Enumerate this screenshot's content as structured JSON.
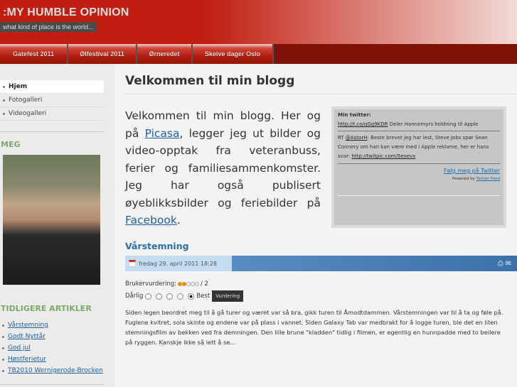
{
  "header": {
    "title": ":MY HUMBLE OPINION",
    "tagline": "what kind of place is the world..."
  },
  "nav": [
    {
      "label": "Gatefest 2011"
    },
    {
      "label": "Ølfestival 2011"
    },
    {
      "label": "Ørneredet"
    },
    {
      "label": "Skeive dager Oslo"
    }
  ],
  "sidebar": {
    "menu": [
      {
        "label": "Hjem"
      },
      {
        "label": "Fotogalleri"
      },
      {
        "label": "Videogalleri"
      }
    ],
    "meg_heading": "MEG",
    "articles_heading": "TIDLIGERE ARTIKLER",
    "articles": [
      {
        "label": "Vårstemning"
      },
      {
        "label": "Godt Nyttår"
      },
      {
        "label": "God jul"
      },
      {
        "label": "Høstferietur"
      },
      {
        "label": "TB2010 Wernigerode-Brocken"
      }
    ]
  },
  "main": {
    "title": "Velkommen til min blogg",
    "intro_1": "Velkommen til min blogg. Her og på ",
    "intro_link1": "Picasa",
    "intro_2": ", legger jeg ut bilder og video-opptak fra veteranbuss, ferier og familiesammenkomster. Jeg har også publisert øyeblikksbilder og feriebilder på ",
    "intro_link2": "Facebook",
    "intro_3": "."
  },
  "twitter": {
    "heading": "Min twitter:",
    "tweet1_link": "http://t.co/qGg9KDR",
    "tweet1_text": " Deler Hannemyrs holdning til Apple",
    "tweet2_prefix": "RT ",
    "tweet2_user": "@AstorH",
    "tweet2_text": ": Beste brevet jeg har lest, Steve Jobs spør Sean Connery om han kan være med i Apple reklame, her er hans svar: ",
    "tweet2_link": "http://twitpic.com/5eoevx",
    "follow": "Følg meg på Twitter",
    "powered_prefix": "Powered by ",
    "powered_link": "Twitter Feed"
  },
  "post": {
    "title": "Vårstemning",
    "date": "fredag 29. april 2011 18:28",
    "rating_label": "Brukervurdering:",
    "rating_value": 2,
    "rating_max": 5,
    "rating_count": "/ 2",
    "worst": "Dårlig",
    "best": "Best",
    "vote_button": "Vurdering",
    "body": "Siden legen beordret meg til å gå turer og været var så bra, gikk turen til Åmodtdammen. Vårstemningen var til å ta og føle på. Fuglene kvitret, sola skinte og endene var på plass i vannet. Siden Galaxy Tab var medbrakt for å logge turen, ble det en liten stemningsfilm av bekken ved fra demningen. Den lille brune \"kladden\" tidlig i filmen, er egentlig en hunnpadde med to beilere på ryggen. Kanskje ikke så lett å se..."
  }
}
